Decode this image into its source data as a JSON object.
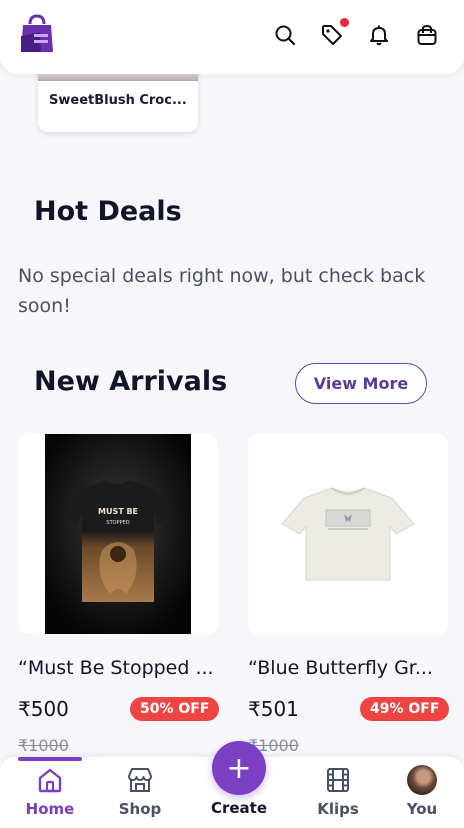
{
  "header": {
    "logo_name": "shopping-bag-logo",
    "icons": [
      "search-icon",
      "tag-icon",
      "bell-icon",
      "bag-icon"
    ],
    "accent": "#7b3fc4",
    "notification_dot": "#ef233c"
  },
  "previous_card": {
    "title": "SweetBlush Croc..."
  },
  "hot_deals": {
    "title": "Hot Deals",
    "message": "No special deals right now, but check back soon!"
  },
  "new_arrivals": {
    "title": "New Arrivals",
    "view_more": "View More",
    "products": [
      {
        "title": "“Must Be Stopped ...",
        "price": "₹500",
        "discount": "50% OFF",
        "original_price": "₹1000",
        "print_text": "MUST BE STOPPED"
      },
      {
        "title": "“Blue Butterfly Gr...",
        "price": "₹501",
        "discount": "49% OFF",
        "original_price": "₹1000"
      }
    ]
  },
  "bottom_nav": {
    "items": [
      {
        "label": "Home",
        "icon": "home-icon",
        "active": true
      },
      {
        "label": "Shop",
        "icon": "shop-icon",
        "active": false
      },
      {
        "label": "Create",
        "icon": "plus-icon",
        "active": false
      },
      {
        "label": "Klips",
        "icon": "film-icon",
        "active": false
      },
      {
        "label": "You",
        "icon": "avatar",
        "active": false
      }
    ]
  }
}
